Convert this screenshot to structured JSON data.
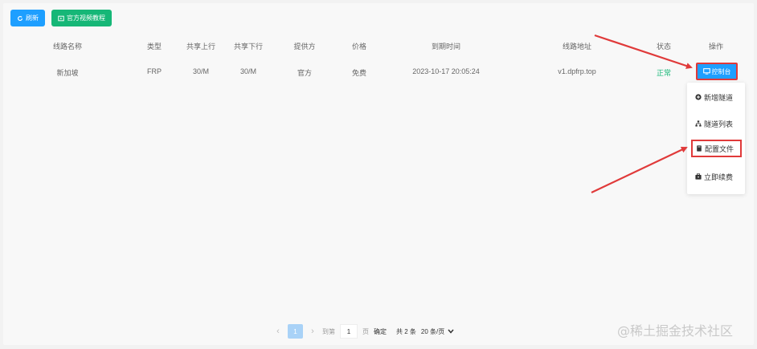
{
  "toolbar": {
    "refresh_label": "刷新",
    "tutorial_label": "官方视频教程"
  },
  "table": {
    "headers": [
      "线路名称",
      "类型",
      "共享上行",
      "共享下行",
      "提供方",
      "价格",
      "到期时间",
      "线路地址",
      "状态",
      "操作"
    ],
    "rows": [
      {
        "name": "新加坡",
        "type": "FRP",
        "upstream": "30/M",
        "downstream": "30/M",
        "provider": "官方",
        "price": "免费",
        "expire": "2023-10-17 20:05:24",
        "address": "v1.dpfrp.top",
        "status": "正常",
        "action_label": "控制台"
      }
    ]
  },
  "dropdown": {
    "items": [
      {
        "label": "新增隧道",
        "icon": "plus-circle-icon"
      },
      {
        "label": "隧道列表",
        "icon": "sitemap-icon"
      },
      {
        "label": "配置文件",
        "icon": "file-icon"
      },
      {
        "label": "立即续费",
        "icon": "wallet-icon"
      }
    ]
  },
  "pagination": {
    "prev": "‹",
    "current_page": "1",
    "next": "›",
    "goto_label": "到第",
    "goto_value": "1",
    "page_label": "页",
    "confirm_label": "确定",
    "total_label": "共 2 条",
    "page_size_label": "20 条/页"
  },
  "watermark": "@稀土掘金技术社区",
  "colors": {
    "primary": "#1e9fff",
    "success": "#16b777",
    "highlight": "#e03a3a"
  }
}
